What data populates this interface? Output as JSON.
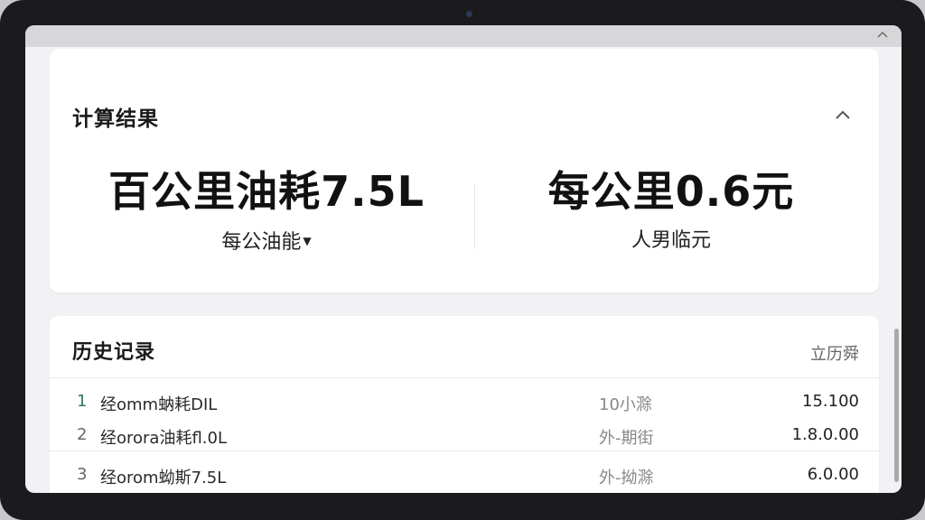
{
  "result": {
    "title": "计算结果",
    "collapse_icon": "chevron-up-icon",
    "left": {
      "value": "百公里油耗7.5L",
      "sub": "每公油能",
      "dropdown_icon": "caret-down-icon"
    },
    "right": {
      "value": "每公里0.6元",
      "sub": "人男临元"
    }
  },
  "history": {
    "title": "历史记录",
    "action": "立历舜",
    "rows": [
      {
        "index": "1",
        "desc": "经omm蚋耗DIL",
        "time": "10小滁",
        "amount": "15.100"
      },
      {
        "index": "2",
        "desc": "经orora油耗fl.0L",
        "time": "外-期街",
        "amount": "1.8.0.00"
      },
      {
        "index": "3",
        "desc": "经orom蚴斯7.5L",
        "time": "外-拗滁",
        "amount": "6.0.00"
      }
    ]
  },
  "colors": {
    "accent_index": "#2f7a55",
    "card_bg": "#ffffff",
    "screen_bg": "#f2f2f4"
  }
}
